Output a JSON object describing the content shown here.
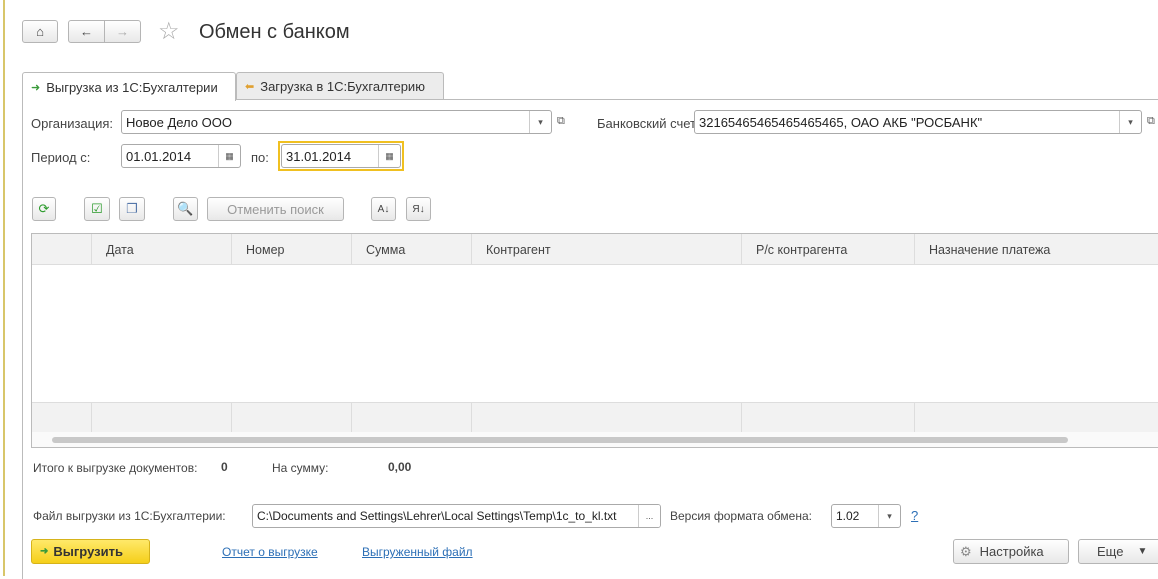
{
  "header": {
    "title": "Обмен с банком"
  },
  "tabs": [
    {
      "label": "Выгрузка из 1С:Бухгалтерии",
      "active": true
    },
    {
      "label": "Загрузка в 1С:Бухгалтерию",
      "active": false
    }
  ],
  "form": {
    "org_label": "Организация:",
    "org_value": "Новое Дело ООО",
    "account_label": "Банковский счет:",
    "account_value": "32165465465465465465, ОАО АКБ \"РОСБАНК\"",
    "period_label": "Период с:",
    "period_from": "01.01.2014",
    "period_to_label": "по:",
    "period_to": "31.01.2014"
  },
  "toolbar": {
    "cancel_search": "Отменить поиск"
  },
  "table": {
    "columns": [
      "Дата",
      "Номер",
      "Сумма",
      "Контрагент",
      "Р/с контрагента",
      "Назначение платежа"
    ]
  },
  "totals": {
    "docs_label": "Итого к выгрузке документов:",
    "docs_value": "0",
    "sum_label": "На сумму:",
    "sum_value": "0,00"
  },
  "file": {
    "label": "Файл выгрузки из 1С:Бухгалтерии:",
    "value": "C:\\Documents and Settings\\Lehrer\\Local Settings\\Temp\\1c_to_kl.txt",
    "version_label": "Версия формата обмена:",
    "version_value": "1.02",
    "help": "?"
  },
  "actions": {
    "export": "Выгрузить",
    "report_link": "Отчет о выгрузке",
    "file_link": "Выгруженный файл",
    "settings": "Настройка",
    "more": "Еще"
  }
}
